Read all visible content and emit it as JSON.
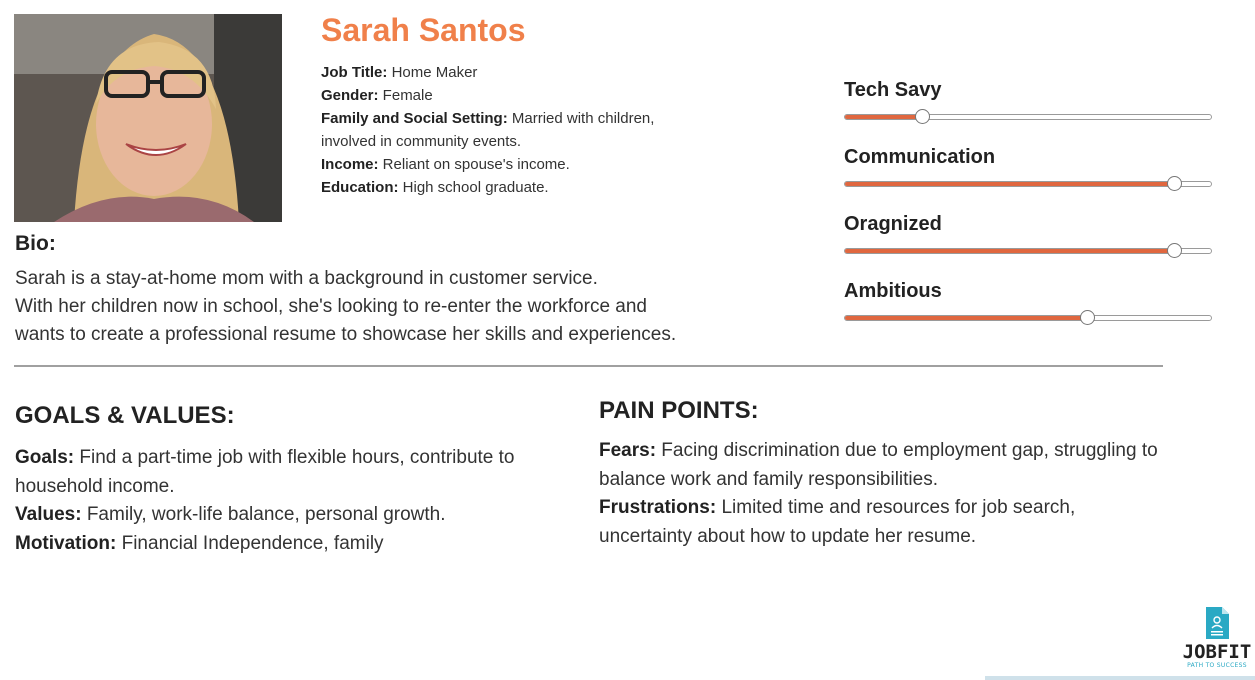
{
  "persona": {
    "name": "Sarah Santos",
    "details": [
      {
        "label": "Job Title:",
        "value": " Home Maker"
      },
      {
        "label": "Gender:",
        "value": " Female"
      },
      {
        "label": "Family and Social Setting:",
        "value": " Married with children, involved in community events."
      },
      {
        "label": "Income:",
        "value": " Reliant on spouse's income."
      },
      {
        "label": "Education:",
        "value": " High school graduate."
      }
    ]
  },
  "bio": {
    "title": "Bio:",
    "lines": [
      "Sarah is a stay-at-home mom with a background in customer service.",
      "With her children now in school, she's looking to re-enter the workforce and",
      "wants to create a professional resume to showcase her skills and experiences."
    ]
  },
  "traits": [
    {
      "label": "Tech Savy",
      "level": 0.21
    },
    {
      "label": "Communication",
      "level": 0.9
    },
    {
      "label": "Oragnized",
      "level": 0.9
    },
    {
      "label": "Ambitious",
      "level": 0.66
    }
  ],
  "goals": {
    "title": "GOALS & VALUES:",
    "items": [
      {
        "label": "Goals:",
        "value": " Find a part-time job with flexible hours, contribute to household income."
      },
      {
        "label": "Values:",
        "value": " Family, work-life balance, personal growth."
      },
      {
        "label": "Motivation:",
        "value": " Financial Independence, family"
      }
    ]
  },
  "pain_points": {
    "title": "PAIN POINTS:",
    "items": [
      {
        "label": "Fears:",
        "value": " Facing discrimination due to employment gap, struggling to balance work and family responsibilities."
      },
      {
        "label": "Frustrations:",
        "value": " Limited time and resources for job search, uncertainty about how to update her resume."
      }
    ]
  },
  "logo": {
    "word": "JOBFIT",
    "tagline": "PATH TO SUCCESS"
  },
  "colors": {
    "accent": "#f0804a",
    "slider_fill": "#e0673f",
    "logo_teal": "#2aa9c4"
  }
}
